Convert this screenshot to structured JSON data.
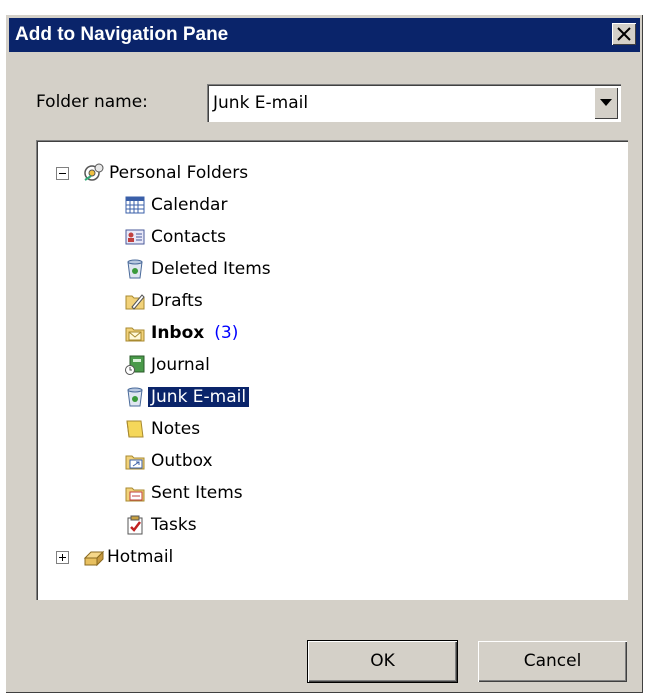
{
  "dialog": {
    "title": "Add to Navigation Pane",
    "close_glyph": "✕"
  },
  "folder_field": {
    "label": "Folder name:",
    "value": "Junk E-mail"
  },
  "tree": {
    "root": {
      "label": "Personal Folders",
      "expanded": true,
      "icon": "personal-folders-icon",
      "children": [
        {
          "label": "Calendar",
          "icon": "calendar-icon"
        },
        {
          "label": "Contacts",
          "icon": "contacts-icon"
        },
        {
          "label": "Deleted Items",
          "icon": "deleted-items-icon"
        },
        {
          "label": "Drafts",
          "icon": "drafts-icon"
        },
        {
          "label": "Inbox",
          "icon": "inbox-icon",
          "bold": true,
          "count": "(3)"
        },
        {
          "label": "Journal",
          "icon": "journal-icon"
        },
        {
          "label": "Junk E-mail",
          "icon": "junk-email-icon",
          "selected": true
        },
        {
          "label": "Notes",
          "icon": "notes-icon"
        },
        {
          "label": "Outbox",
          "icon": "outbox-icon"
        },
        {
          "label": "Sent Items",
          "icon": "sent-items-icon"
        },
        {
          "label": "Tasks",
          "icon": "tasks-icon"
        }
      ]
    },
    "second_root": {
      "label": "Hotmail",
      "expanded": false,
      "icon": "hotmail-icon"
    }
  },
  "buttons": {
    "ok": "OK",
    "cancel": "Cancel"
  },
  "colors": {
    "titlebar": "#0a246a",
    "face": "#d4d0c8",
    "selection": "#0a246a",
    "count": "#0000ff"
  }
}
